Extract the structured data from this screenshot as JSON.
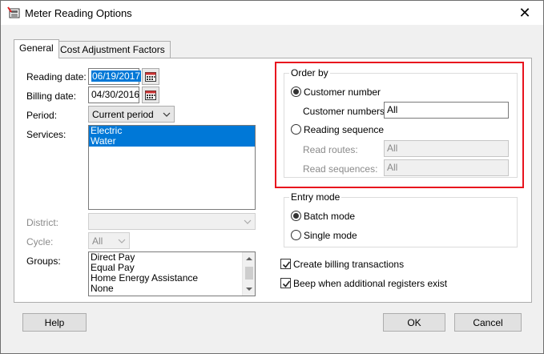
{
  "window": {
    "title": "Meter Reading Options",
    "close_glyph": "✕"
  },
  "tabs": [
    {
      "label": "General"
    },
    {
      "label": "Cost Adjustment Factors"
    }
  ],
  "general": {
    "reading_date": {
      "label": "Reading date:",
      "value": "06/19/2017"
    },
    "billing_date": {
      "label": "Billing date:",
      "value": "04/30/2016"
    },
    "period": {
      "label": "Period:",
      "value": "Current period"
    },
    "services": {
      "label": "Services:",
      "items": [
        "Electric",
        "Water"
      ]
    },
    "district": {
      "label": "District:",
      "value": ""
    },
    "cycle": {
      "label": "Cycle:",
      "value": "All"
    },
    "groups": {
      "label": "Groups:",
      "items": [
        "Direct Pay",
        "Equal Pay",
        "Home Energy Assistance",
        "None"
      ]
    }
  },
  "order_by": {
    "title": "Order by",
    "customer_number": {
      "label": "Customer number",
      "checked": true
    },
    "customer_numbers": {
      "label": "Customer numbers:",
      "value": "All"
    },
    "reading_sequence": {
      "label": "Reading sequence",
      "checked": false
    },
    "read_routes": {
      "label": "Read routes:",
      "value": "All"
    },
    "read_sequences": {
      "label": "Read sequences:",
      "value": "All"
    }
  },
  "entry_mode": {
    "title": "Entry mode",
    "batch": {
      "label": "Batch mode",
      "checked": true
    },
    "single": {
      "label": "Single mode",
      "checked": false
    }
  },
  "options": {
    "create_billing": {
      "label": "Create billing transactions",
      "checked": true
    },
    "beep_registers": {
      "label": "Beep when additional registers exist",
      "checked": true
    }
  },
  "buttons": {
    "help": "Help",
    "ok": "OK",
    "cancel": "Cancel"
  },
  "colors": {
    "highlight": "#0078d7",
    "callout": "#e8131e"
  }
}
